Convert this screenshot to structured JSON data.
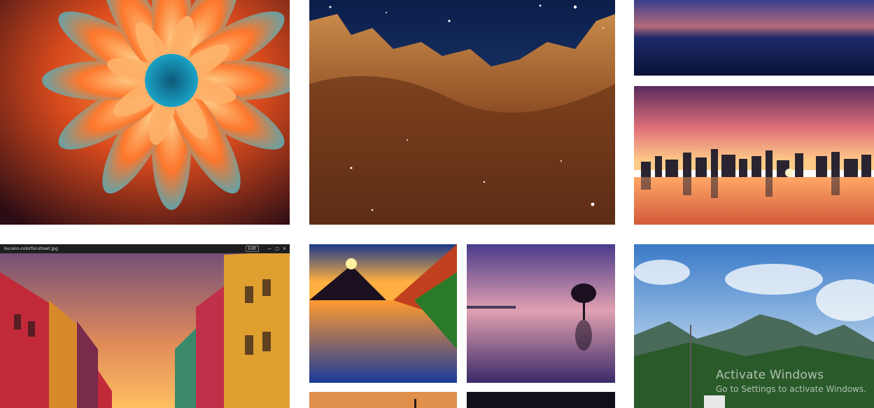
{
  "gallery": {
    "tiles": [
      {
        "id": "flower",
        "subject": "abstract flower"
      },
      {
        "id": "nebula",
        "subject": "space nebula"
      },
      {
        "id": "ocean",
        "subject": "ocean at night"
      },
      {
        "id": "city",
        "subject": "city skyline at sunset"
      },
      {
        "id": "venice",
        "subject": "colorful street at sunset"
      },
      {
        "id": "lake",
        "subject": "volcano lake sunset"
      },
      {
        "id": "tree",
        "subject": "lone tree in lake"
      },
      {
        "id": "mountain",
        "subject": "mountains and sky"
      }
    ]
  },
  "venice_window": {
    "title": "burano-colorful-street.jpg",
    "button": "Edit",
    "controls": [
      "—",
      "▢",
      "✕"
    ]
  },
  "watermark": {
    "title": "Activate Windows",
    "subtitle": "Go to Settings to activate Windows."
  },
  "colors": {
    "background": "#ffffff",
    "watermark": "rgba(255,255,255,0.62)"
  }
}
